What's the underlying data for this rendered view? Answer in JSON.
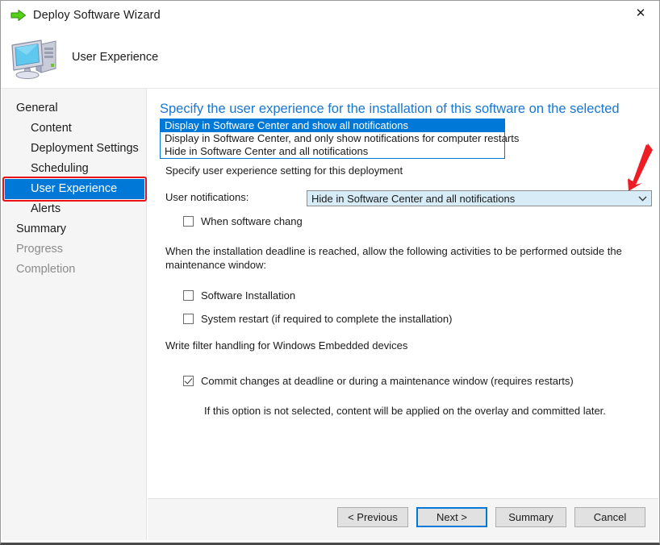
{
  "window": {
    "title": "Deploy Software Wizard",
    "title_icon": "green-right-arrow-icon",
    "close_label": "✕"
  },
  "header": {
    "icon": "computer-icon",
    "title": "User Experience"
  },
  "sidebar": {
    "items": [
      {
        "label": "General",
        "level": 1,
        "state": "normal"
      },
      {
        "label": "Content",
        "level": 2,
        "state": "normal"
      },
      {
        "label": "Deployment Settings",
        "level": 2,
        "state": "normal"
      },
      {
        "label": "Scheduling",
        "level": 2,
        "state": "normal"
      },
      {
        "label": "User Experience",
        "level": 2,
        "state": "selected"
      },
      {
        "label": "Alerts",
        "level": 2,
        "state": "normal"
      },
      {
        "label": "Summary",
        "level": 1,
        "state": "normal"
      },
      {
        "label": "Progress",
        "level": 1,
        "state": "disabled"
      },
      {
        "label": "Completion",
        "level": 1,
        "state": "disabled"
      }
    ]
  },
  "main": {
    "heading": "Specify the user experience for the installation of this software on the selected devices",
    "intro": "Specify user experience setting for this deployment",
    "notifications": {
      "label": "User notifications:",
      "selected_value": "Hide in Software Center and all notifications",
      "chevron": "chevron-down-icon",
      "expanded": true,
      "options": [
        "Display in Software Center and show all notifications",
        "Display in Software Center, and only show notifications for computer restarts",
        "Hide in Software Center and all notifications"
      ],
      "highlighted_index": 0
    },
    "software_change_checkbox": {
      "label": "When software chang",
      "checked": false
    },
    "deadline_paragraph": "When the installation deadline is reached, allow the following activities to be performed outside the maintenance window:",
    "deadline_checkboxes": [
      {
        "label": "Software Installation",
        "checked": false
      },
      {
        "label": "System restart  (if required to complete the installation)",
        "checked": false
      }
    ],
    "write_filter_heading": "Write filter handling for Windows Embedded devices",
    "write_filter_checkbox": {
      "label": "Commit changes at deadline or during a maintenance window (requires restarts)",
      "checked": true
    },
    "write_filter_note": "If this option is not selected, content will be applied on the overlay and committed later."
  },
  "footer": {
    "buttons": [
      {
        "label": "< Previous",
        "focused": false
      },
      {
        "label": "Next >",
        "focused": true
      },
      {
        "label": "Summary",
        "focused": false
      },
      {
        "label": "Cancel",
        "focused": false
      }
    ]
  },
  "annotations": {
    "arrow_color": "#ee1c25",
    "highlight_box_color": "#e8111a"
  },
  "colors": {
    "heading_blue": "#1976d2",
    "selection_blue": "#0078d7",
    "combo_background": "#d7ecf7",
    "panel_gray": "#f5f5f5"
  }
}
